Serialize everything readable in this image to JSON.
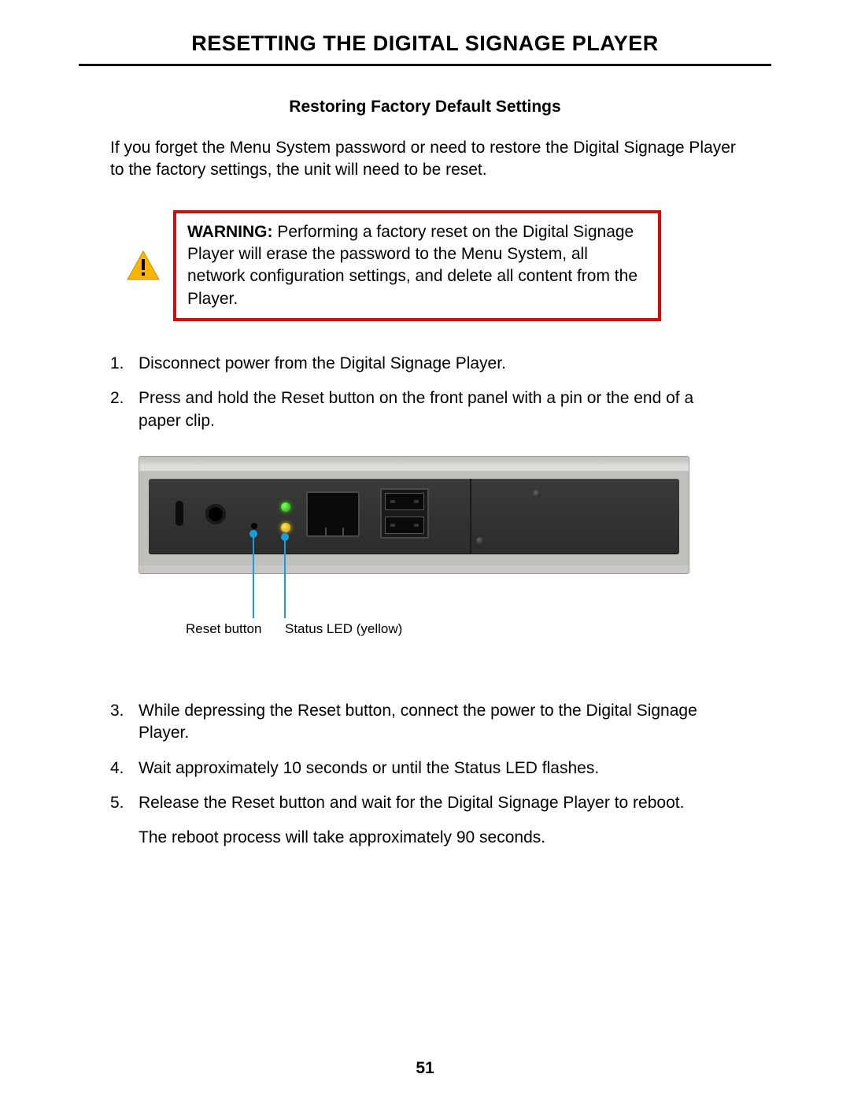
{
  "title": "RESETTING THE DIGITAL SIGNAGE PLAYER",
  "section_title": "Restoring Factory Default Settings",
  "intro": "If you forget the Menu System password or need to restore the Digital Signage Player to the factory settings, the unit will need to be reset.",
  "warning": {
    "label": "WARNING:",
    "text": " Performing a factory reset on the Digital Signage Player will erase the password to the Menu System, all network configuration settings, and delete all content from the Player."
  },
  "steps_a": [
    {
      "num": "1.",
      "text": "Disconnect power from the Digital Signage Player."
    },
    {
      "num": "2.",
      "text": "Press and hold the Reset button on the front panel with a pin or the end of a paper clip."
    }
  ],
  "callouts": {
    "reset": "Reset button",
    "status": "Status LED (yellow)"
  },
  "steps_b": [
    {
      "num": "3.",
      "text": "While depressing the Reset button, connect the power to the Digital Signage Player."
    },
    {
      "num": "4.",
      "text": "Wait approximately 10 seconds or until the Status LED flashes."
    },
    {
      "num": "5.",
      "text": "Release the Reset button and wait for the Digital Signage Player to reboot."
    }
  ],
  "footer": "The reboot process will take approximately 90 seconds.",
  "page_number": "51"
}
